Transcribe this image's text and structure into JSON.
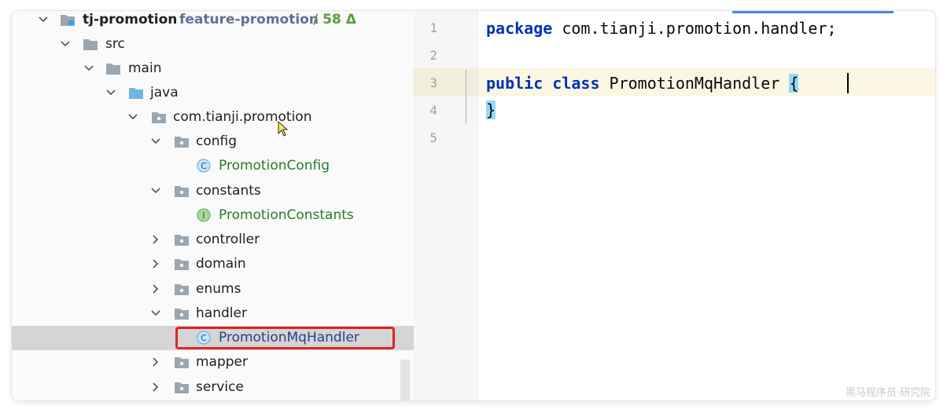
{
  "tree": {
    "project": {
      "name": "tj-promotion",
      "branch": "feature-promotion",
      "changes": "/ 58 Δ"
    },
    "rows": [
      {
        "label": "src",
        "kind": "folder",
        "style": "normal",
        "expanded": true
      },
      {
        "label": "main",
        "kind": "folder",
        "style": "normal",
        "expanded": true
      },
      {
        "label": "java",
        "kind": "source-folder",
        "style": "normal",
        "expanded": true
      },
      {
        "label": "com.tianji.promotion",
        "kind": "package",
        "style": "normal",
        "expanded": true
      },
      {
        "label": "config",
        "kind": "package",
        "style": "normal",
        "expanded": true
      },
      {
        "label": "PromotionConfig",
        "kind": "class",
        "style": "green"
      },
      {
        "label": "constants",
        "kind": "package",
        "style": "normal",
        "expanded": true
      },
      {
        "label": "PromotionConstants",
        "kind": "interface",
        "style": "green"
      },
      {
        "label": "controller",
        "kind": "package",
        "style": "normal",
        "expanded": false
      },
      {
        "label": "domain",
        "kind": "package",
        "style": "normal",
        "expanded": false
      },
      {
        "label": "enums",
        "kind": "package",
        "style": "normal",
        "expanded": false
      },
      {
        "label": "handler",
        "kind": "package",
        "style": "normal",
        "expanded": true
      },
      {
        "label": "PromotionMqHandler",
        "kind": "class",
        "style": "blue",
        "selected": true
      },
      {
        "label": "mapper",
        "kind": "package",
        "style": "normal",
        "expanded": false
      },
      {
        "label": "service",
        "kind": "package",
        "style": "normal",
        "expanded": false
      }
    ],
    "class_badge": "C",
    "interface_badge": "I"
  },
  "editor": {
    "line_numbers": [
      "1",
      "2",
      "3",
      "4",
      "5"
    ],
    "lines": [
      {
        "kw": "package",
        "rest": " com.tianji.promotion.handler;"
      },
      {
        "kw": "",
        "rest": ""
      },
      {
        "kw": "public class",
        "rest": " PromotionMqHandler ",
        "brace": "{"
      },
      {
        "kw": "",
        "rest": "",
        "brace": "}"
      },
      {
        "kw": "",
        "rest": ""
      }
    ]
  },
  "watermark": "黑马程序员·研究院",
  "colors": {
    "keyword": "#0033b3",
    "class_green": "#287a2e",
    "selected_blue": "#2a3d91",
    "highlight_red": "#e02424",
    "brace_highlight": "#93d9f9"
  }
}
